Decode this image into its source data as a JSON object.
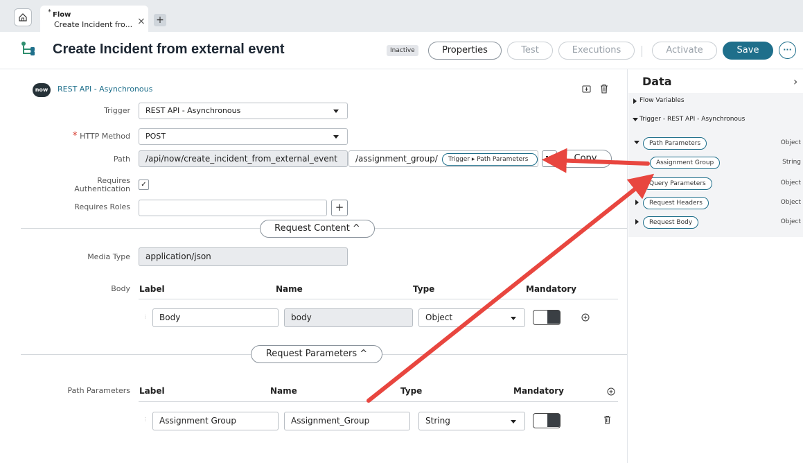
{
  "tabs": {
    "modified_marker": "*",
    "tab_type": "Flow",
    "tab_title": "Create Incident fro...",
    "close": "×",
    "add": "+"
  },
  "header": {
    "title": "Create Incident from external event",
    "status_badge": "Inactive",
    "properties": "Properties",
    "test": "Test",
    "executions": "Executions",
    "activate": "Activate",
    "save": "Save",
    "more": "···"
  },
  "trigger": {
    "logo": "now",
    "title": "REST API - Asynchronous",
    "trigger_label": "Trigger",
    "trigger_value": "REST API - Asynchronous",
    "required_star": "*",
    "method_label": "HTTP Method",
    "method_value": "POST",
    "path_label": "Path",
    "path_base": "/api/now/create_incident_from_external_event",
    "path_suffix": "/assignment_group/",
    "path_pill": "Trigger ▸ Path Parameters",
    "copy": "Copy",
    "auth_label_1": "Requires",
    "auth_label_2": "Authentication",
    "auth_checked": "✓",
    "roles_label": "Requires Roles",
    "roles_add": "+"
  },
  "request_content": {
    "section": "Request Content ^",
    "media_label": "Media Type",
    "media_value": "application/json",
    "body_label": "Body",
    "columns": [
      "Label",
      "Name",
      "Type",
      "Mandatory"
    ],
    "row": {
      "label": "Body",
      "name": "body",
      "type": "Object"
    }
  },
  "request_parameters": {
    "section": "Request Parameters ^",
    "path_params_label": "Path Parameters",
    "columns": [
      "Label",
      "Name",
      "Type",
      "Mandatory"
    ],
    "row": {
      "label": "Assignment Group",
      "name": "Assignment_Group",
      "type": "String"
    }
  },
  "data_panel": {
    "title": "Data",
    "flow_variables": "Flow Variables",
    "trigger_node": "Trigger - REST API - Asynchronous",
    "items": [
      {
        "label": "Path Parameters",
        "type": "Object"
      },
      {
        "label": "Assignment Group",
        "type": "String"
      },
      {
        "label": "Query Parameters",
        "type": "Object"
      },
      {
        "label": "Request Headers",
        "type": "Object"
      },
      {
        "label": "Request Body",
        "type": "Object"
      }
    ]
  },
  "colors": {
    "accent": "#1f6f8b",
    "annotation_arrow": "#e8463f"
  }
}
